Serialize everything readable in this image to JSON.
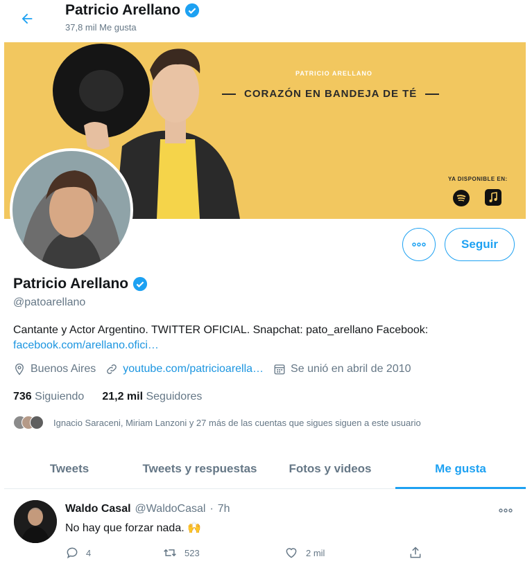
{
  "header": {
    "name": "Patricio Arellano",
    "likes_count": "37,8 mil Me gusta"
  },
  "banner": {
    "small_title": "PATRICIO ARELLANO",
    "title": "CORAZÓN EN BANDEJA DE TÉ",
    "available": "YA DISPONIBLE EN:"
  },
  "actions": {
    "follow_label": "Seguir"
  },
  "profile": {
    "name": "Patricio Arellano",
    "handle": "@patoarellano",
    "bio_text": "Cantante y Actor Argentino. TWITTER OFICIAL. Snapchat: pato_arellano  Facebook:",
    "bio_link": "facebook.com/arellano.ofici…",
    "location": "Buenos Aires",
    "website": "youtube.com/patricioarella…",
    "joined": "Se unió en abril de 2010",
    "following_count": "736",
    "following_label": "Siguiendo",
    "followers_count": "21,2 mil",
    "followers_label": "Seguidores",
    "mutuals_text": "Ignacio Saraceni, Miriam Lanzoni y 27 más de las cuentas que sigues siguen a este usuario"
  },
  "tabs": [
    {
      "label": "Tweets"
    },
    {
      "label": "Tweets y respuestas"
    },
    {
      "label": "Fotos y videos"
    },
    {
      "label": "Me gusta"
    }
  ],
  "tweet": {
    "author": "Waldo Casal",
    "handle": "@WaldoCasal",
    "separator": "·",
    "time": "7h",
    "text": "No hay que forzar nada. 🙌",
    "replies": "4",
    "retweets": "523",
    "likes": "2 mil"
  },
  "colors": {
    "accent": "#1da1f2",
    "link": "#1b95e0",
    "banner": "#f2c75f",
    "secondary_text": "#657786"
  }
}
